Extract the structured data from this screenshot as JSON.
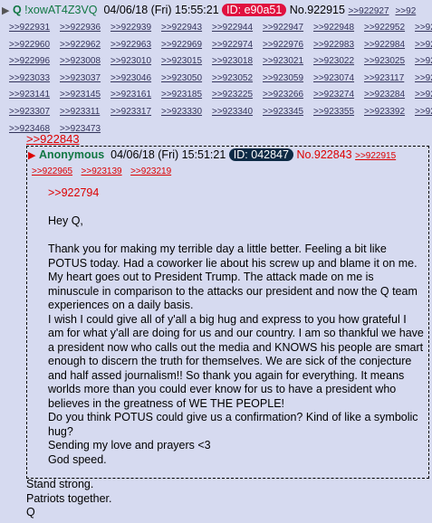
{
  "op": {
    "tripname": "Q",
    "tripcode": "!xowAT4Z3VQ",
    "datetime": "04/06/18 (Fri) 15:55:21",
    "id": "ID: e90a51",
    "number": "No.922915",
    "header_replies": [
      ">>922927",
      ">>92"
    ],
    "replies": [
      ">>922931",
      ">>922936",
      ">>922939",
      ">>922943",
      ">>922944",
      ">>922947",
      ">>922948",
      ">>922952",
      ">>92",
      ">>922960",
      ">>922962",
      ">>922963",
      ">>922969",
      ">>922974",
      ">>922976",
      ">>922983",
      ">>922984",
      ">>92",
      ">>922996",
      ">>923008",
      ">>923010",
      ">>923015",
      ">>923018",
      ">>923021",
      ">>923022",
      ">>923025",
      ">>92",
      ">>923033",
      ">>923037",
      ">>923046",
      ">>923050",
      ">>923052",
      ">>923059",
      ">>923074",
      ">>923117",
      ">>92",
      ">>923141",
      ">>923145",
      ">>923161",
      ">>923185",
      ">>923225",
      ">>923266",
      ">>923274",
      ">>923284",
      ">>92",
      ">>923307",
      ">>923311",
      ">>923317",
      ">>923330",
      ">>923340",
      ">>923345",
      ">>923355",
      ">>923392",
      ">>92",
      ">>923468",
      ">>923473"
    ],
    "tail": [
      "Stand strong.",
      "Patriots together.",
      "Q"
    ]
  },
  "quote_link": ">>922843",
  "quoted": {
    "name": "Anonymous",
    "datetime": "04/06/18 (Fri) 15:51:21",
    "id": "ID: 042847",
    "number": "No.922843",
    "replies": [
      ">>922915",
      ">>922965",
      ">>923139",
      ">>923219"
    ],
    "greentext": ">>922794",
    "lines": [
      "Hey Q,",
      "",
      "Thank you for making my terrible day a little better. Feeling a bit like POTUS today. Had a coworker lie about his screw up and blame it on me. My heart goes out to President Trump. The attack made on me is minuscule in comparison to the attacks our president and now the Q team experiences on a daily basis.",
      "I wish I could give all of y'all a big hug and express to you how grateful I am for what y'all are doing for us and our country. I am so thankful we have a president now who calls out the media and KNOWS his people are smart enough to discern the truth for themselves. We are sick of the conjecture and half assed journalism!! So thank you again for everything. It means worlds more than you could ever know for us to have a president who believes in the greatness of WE THE PEOPLE!",
      "Do you think POTUS could give us a confirmation? Kind of like a symbolic hug?",
      "Sending my love and prayers <3",
      "God speed."
    ]
  }
}
